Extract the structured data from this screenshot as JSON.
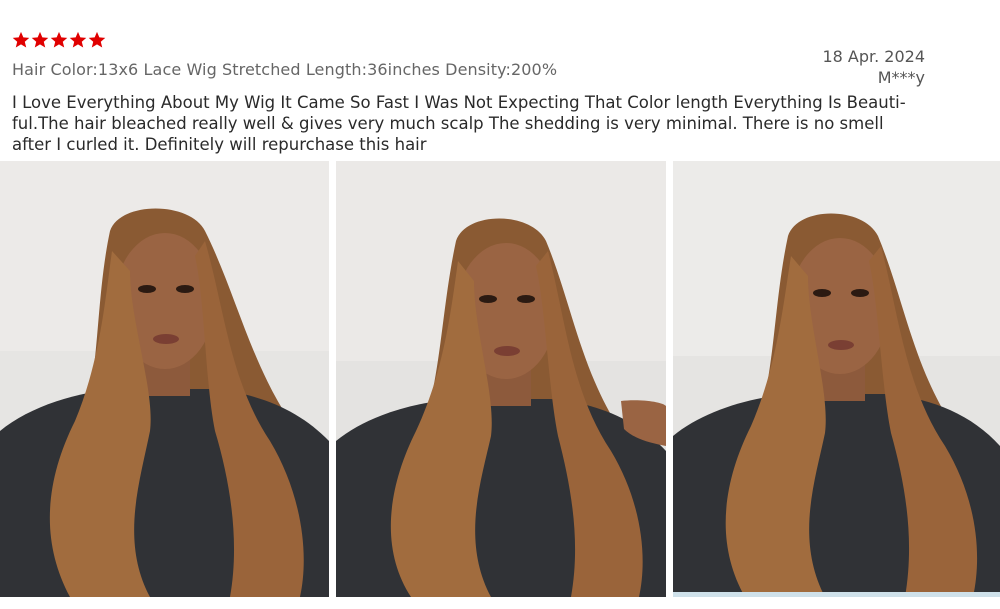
{
  "review": {
    "rating": 5,
    "rating_color": "#e00000",
    "spec": "Hair Color:13x6 Lace Wig Stretched Length:36inches Density:200%",
    "date": "18 Apr. 2024",
    "author": "M***y",
    "text": "I Love Everything About My Wig It Came So Fast I Was Not Expecting That Color length Everything Is Beauti-ful.The hair bleached really well & gives very much scalp The shedding is very minimal. There is no smell after I curled it. Definitely will repurchase this hair",
    "photos": [
      "review-photo",
      "review-photo",
      "review-photo"
    ]
  }
}
